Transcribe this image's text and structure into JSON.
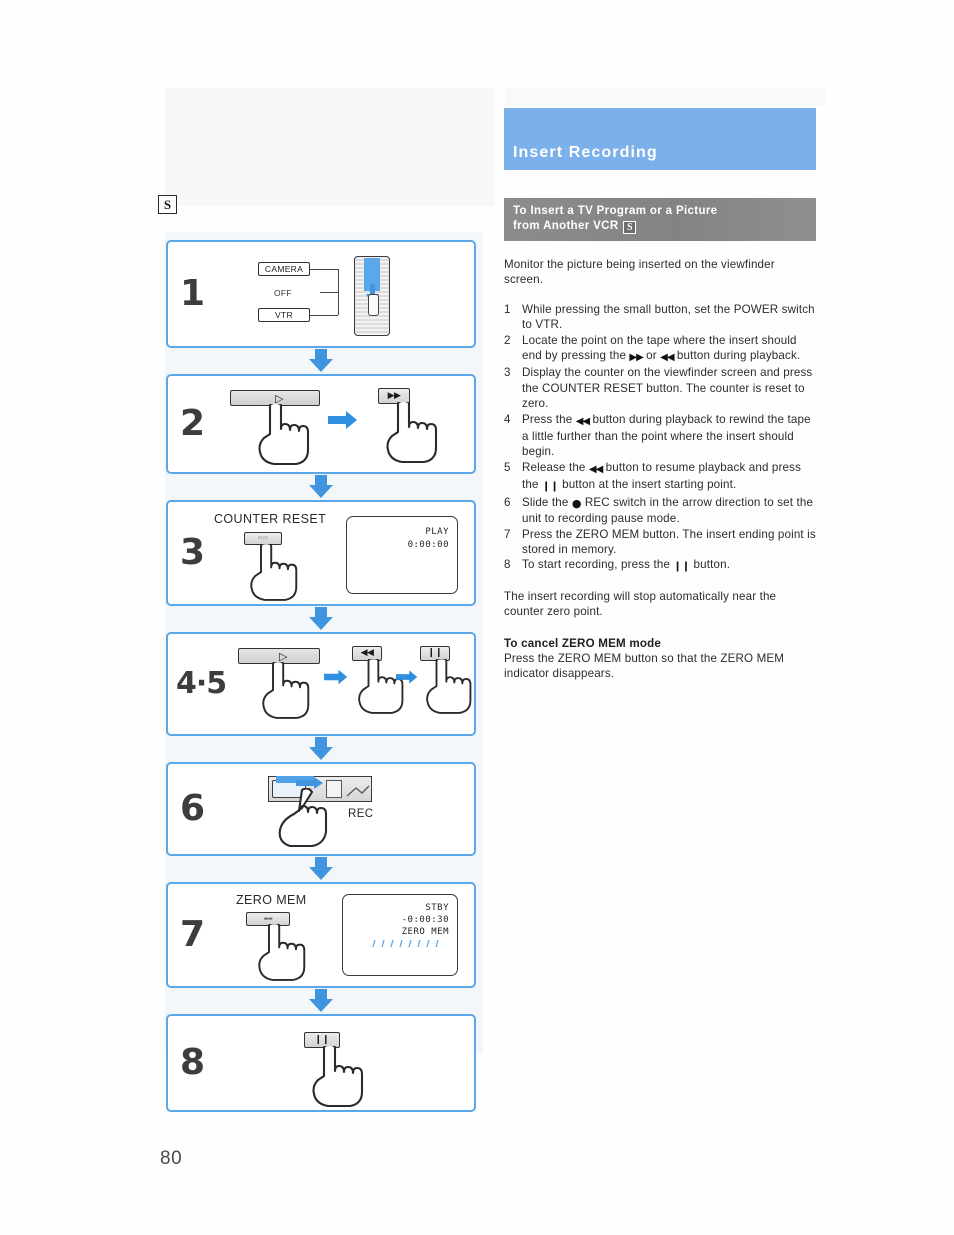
{
  "page": {
    "number": "80",
    "accent_blue": "#7cb0ea",
    "panel_border_blue": "#5ba7e8",
    "subtitle_gray": "#868686"
  },
  "badges": {
    "standalone_s": "S",
    "inline_s": "S"
  },
  "header": {
    "title": "Insert Recording",
    "subtitle_line1": "To Insert a TV Program or a Picture",
    "subtitle_line2": "from Another VCR"
  },
  "intro": "Monitor the picture being inserted on the viewfinder screen.",
  "steps": [
    {
      "num": "1",
      "parts": [
        {
          "t": "text",
          "v": "While pressing the small button, set the POWER switch to VTR."
        }
      ]
    },
    {
      "num": "2",
      "parts": [
        {
          "t": "text",
          "v": "Locate the point on the tape where the insert should end by pressing the "
        },
        {
          "t": "icon",
          "v": "▶▶",
          "name": "fast-forward-glyph"
        },
        {
          "t": "text",
          "v": " or "
        },
        {
          "t": "icon",
          "v": "◀◀",
          "name": "rewind-glyph"
        },
        {
          "t": "text",
          "v": " button during playback."
        }
      ]
    },
    {
      "num": "3",
      "parts": [
        {
          "t": "text",
          "v": "Display the counter on the viewfinder screen and press the COUNTER RESET button. The counter is reset to zero."
        }
      ]
    },
    {
      "num": "4",
      "parts": [
        {
          "t": "text",
          "v": "Press the "
        },
        {
          "t": "icon",
          "v": "◀◀",
          "name": "rewind-glyph"
        },
        {
          "t": "text",
          "v": " button during playback to rewind the tape a little further than the point where the insert should begin."
        }
      ]
    },
    {
      "num": "5",
      "parts": [
        {
          "t": "text",
          "v": "Release the "
        },
        {
          "t": "icon",
          "v": "◀◀",
          "name": "rewind-glyph"
        },
        {
          "t": "text",
          "v": " button to resume playback and press the "
        },
        {
          "t": "icon",
          "v": "❙❙",
          "name": "pause-glyph"
        },
        {
          "t": "text",
          "v": " button at the insert starting point."
        }
      ]
    },
    {
      "num": "6",
      "parts": [
        {
          "t": "text",
          "v": "Slide the "
        },
        {
          "t": "icon",
          "v": "●",
          "name": "record-dot-glyph"
        },
        {
          "t": "text",
          "v": " REC switch in the arrow direction to set the unit to recording pause mode."
        }
      ]
    },
    {
      "num": "7",
      "parts": [
        {
          "t": "text",
          "v": "Press the ZERO MEM button. The insert ending point is stored in memory."
        }
      ]
    },
    {
      "num": "8",
      "parts": [
        {
          "t": "text",
          "v": "To start recording, press the "
        },
        {
          "t": "icon",
          "v": "❙❙",
          "name": "pause-glyph"
        },
        {
          "t": "text",
          "v": " button."
        }
      ]
    }
  ],
  "closing_note": "The insert recording will stop automatically near the counter zero point.",
  "cancel_section": {
    "heading": "To cancel ZERO MEM mode",
    "body": "Press the ZERO MEM button so that the ZERO MEM indicator disappears."
  },
  "figure_panels": [
    {
      "number": "1",
      "type": "power-switch",
      "switch_labels": {
        "top": "CAMERA",
        "middle": "OFF",
        "bottom": "VTR"
      }
    },
    {
      "number": "2",
      "type": "two-button",
      "buttons": [
        {
          "glyph": "▷",
          "name": "play-button"
        },
        {
          "glyph": "▶▶",
          "name": "fast-forward-button"
        }
      ]
    },
    {
      "number": "3",
      "type": "counter-reset",
      "label": "COUNTER RESET",
      "viewfinder": {
        "line1": "PLAY",
        "line2": "0:00:00"
      }
    },
    {
      "number": "4·5",
      "type": "three-button",
      "buttons": [
        {
          "glyph": "▷",
          "name": "play-button"
        },
        {
          "glyph": "◀◀",
          "name": "rewind-button"
        },
        {
          "glyph": "❙❙",
          "name": "pause-button"
        }
      ]
    },
    {
      "number": "6",
      "type": "rec-slider",
      "label": "REC"
    },
    {
      "number": "7",
      "type": "zero-mem",
      "label": "ZERO MEM",
      "viewfinder": {
        "line1": "STBY",
        "line2": "-0:00:30",
        "line3": "ZERO MEM"
      }
    },
    {
      "number": "8",
      "type": "one-button",
      "buttons": [
        {
          "glyph": "❙❙",
          "name": "pause-button"
        }
      ]
    }
  ]
}
